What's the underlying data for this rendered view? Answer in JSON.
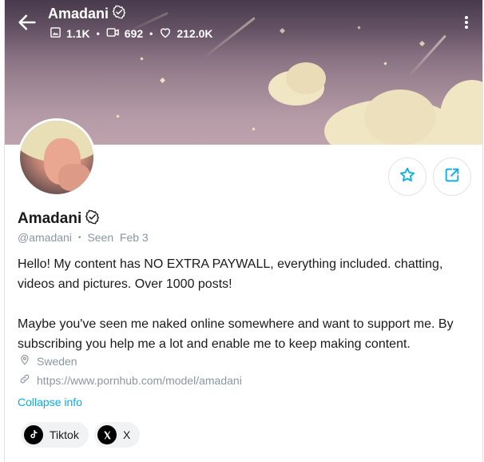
{
  "header": {
    "title": "Amadani",
    "stats": [
      {
        "icon": "image-icon",
        "value": "1.1K"
      },
      {
        "icon": "video-icon",
        "value": "692"
      },
      {
        "icon": "heart-icon",
        "value": "212.0K"
      }
    ]
  },
  "profile": {
    "name": "Amadani",
    "username": "@amadani",
    "seen": "Seen  Feb 3",
    "bio_paragraphs": [
      "Hello! My content has NO EXTRA PAYWALL, everything included. chatting, videos and pictures. Over 1000 posts!",
      "Maybe you've seen me naked online somewhere and want to support me. By subscribing you help me a lot and enable me to keep making content."
    ],
    "location": "Sweden",
    "link": "https://www.pornhub.com/model/amadani",
    "collapse_label": "Collapse info"
  },
  "socials": [
    {
      "label": "Tiktok",
      "icon": "tiktok-icon"
    },
    {
      "label": "X",
      "icon": "x-icon"
    }
  ],
  "colors": {
    "accent": "#00aff0",
    "muted": "#8a96a3",
    "chip_bg": "#f1f2f4"
  }
}
